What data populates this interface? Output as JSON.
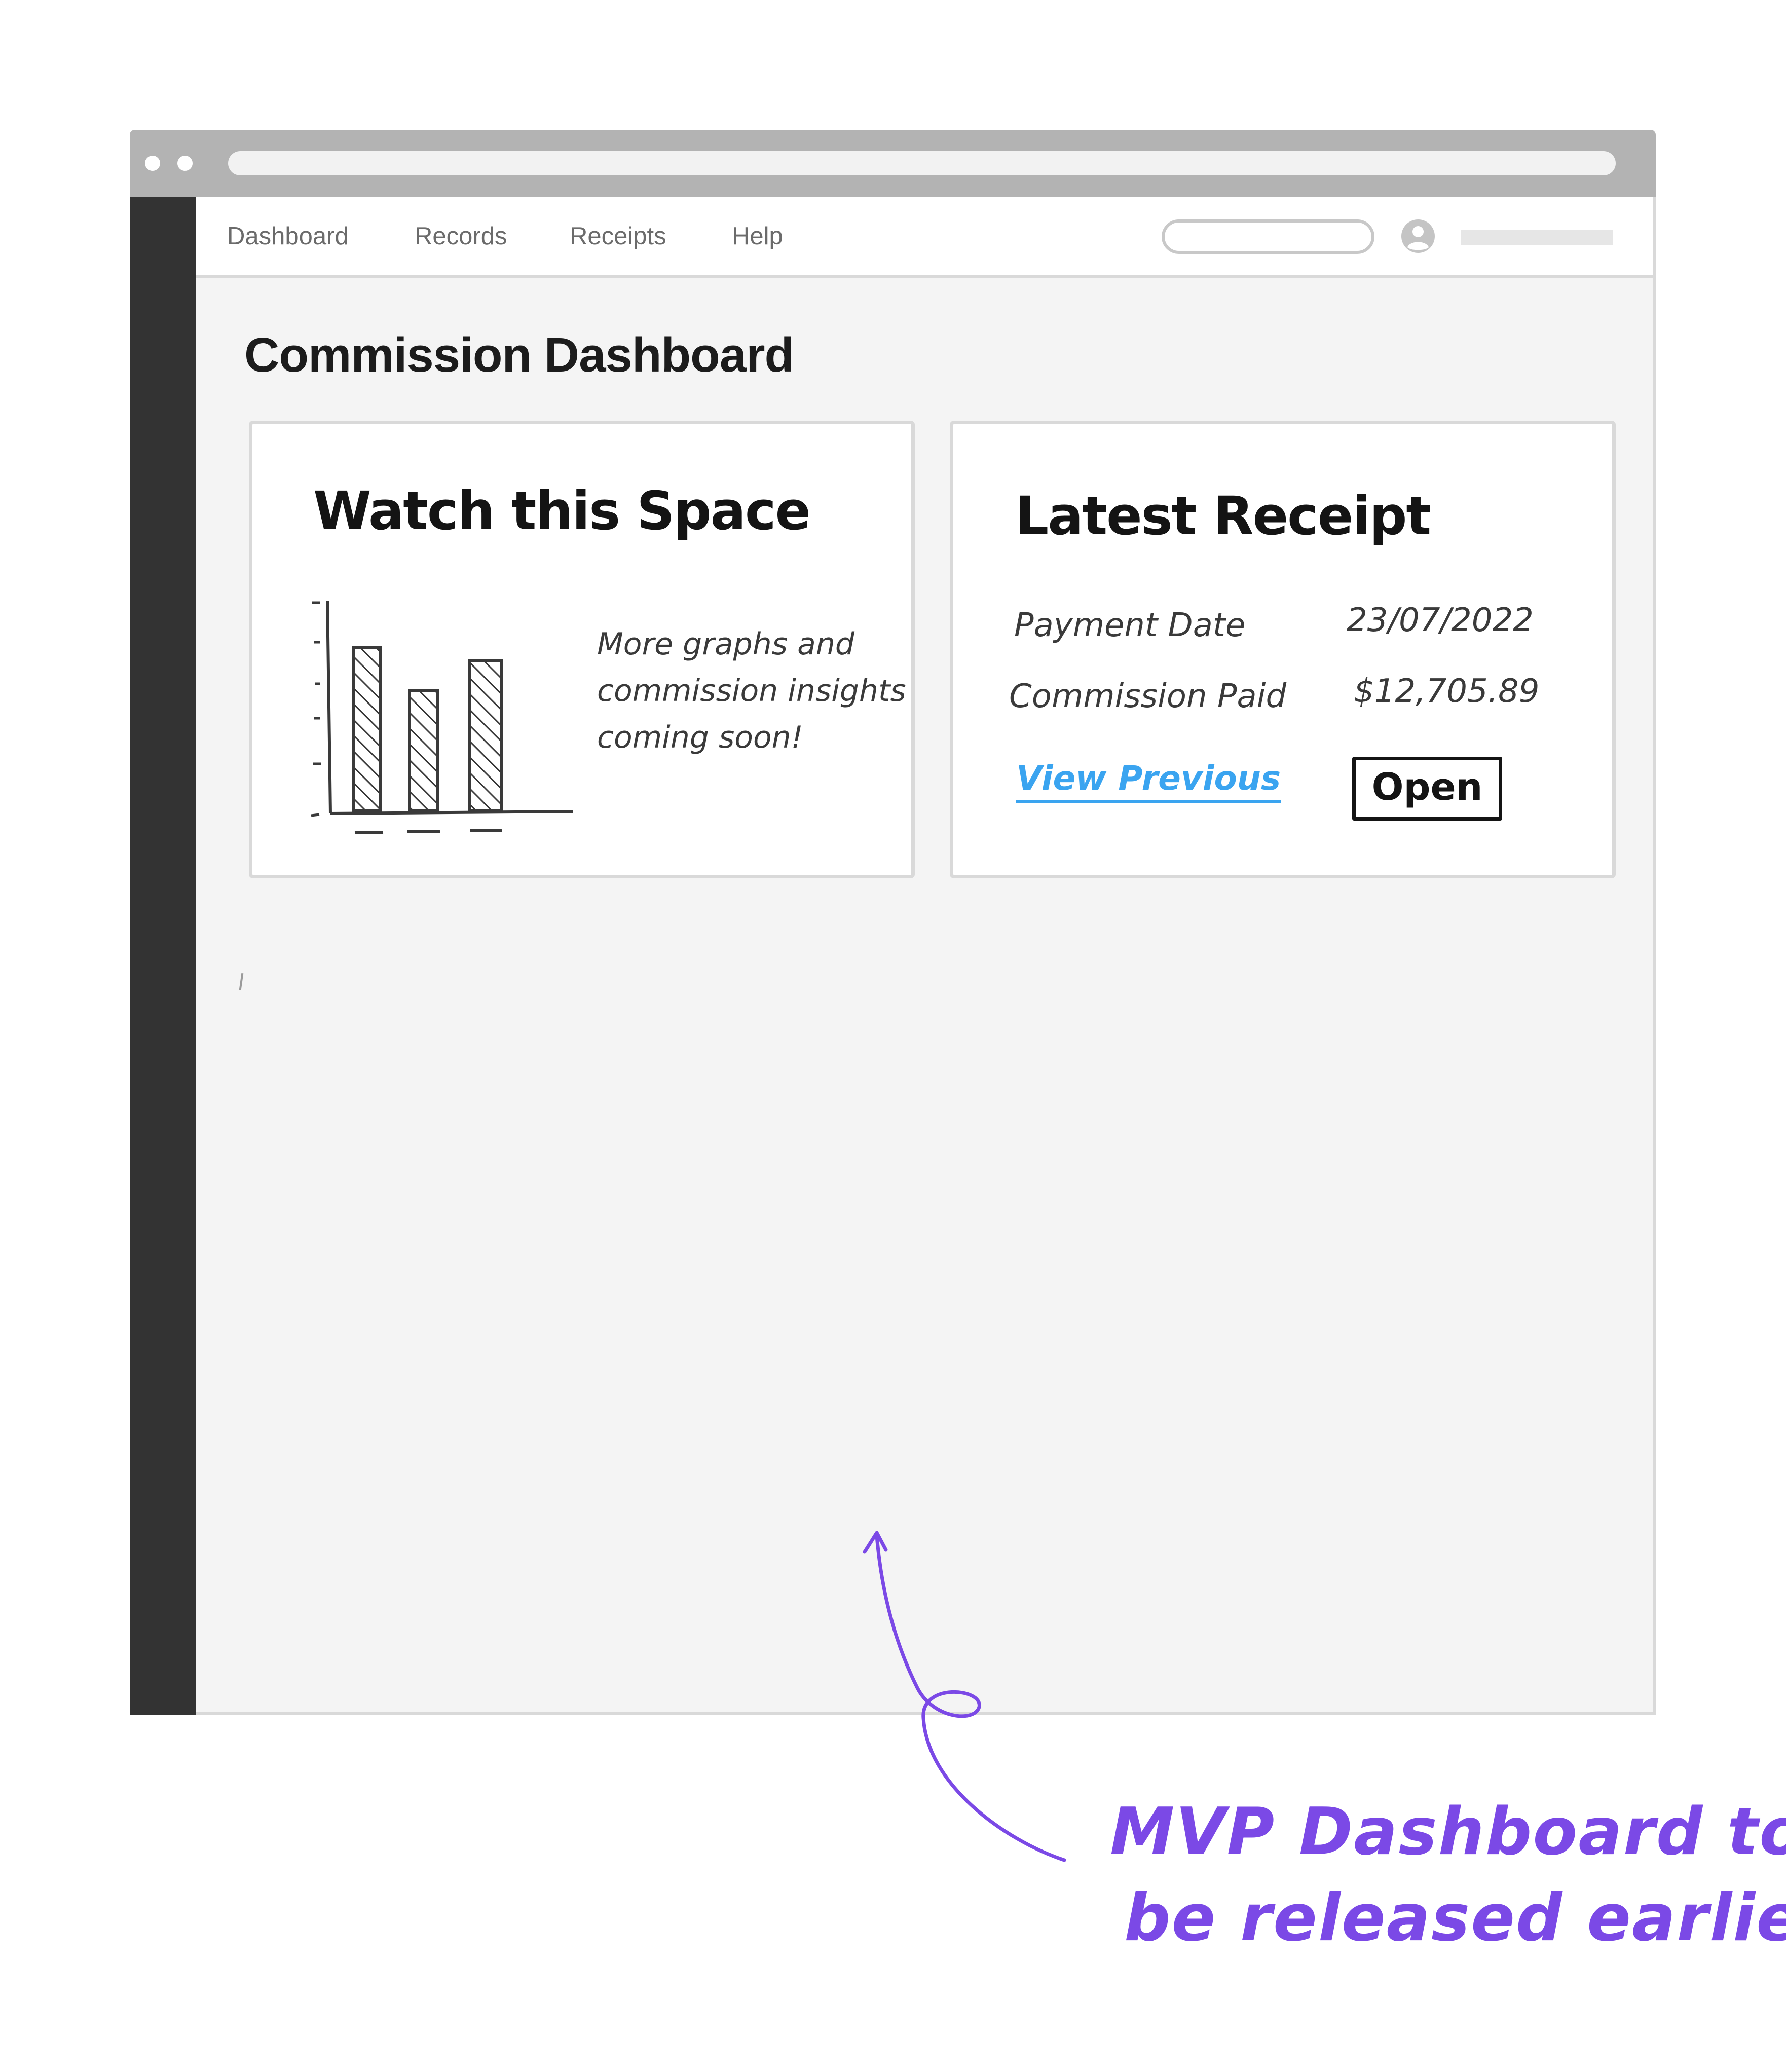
{
  "nav": {
    "items": [
      {
        "label": "Dashboard"
      },
      {
        "label": "Records"
      },
      {
        "label": "Receipts"
      },
      {
        "label": "Help"
      }
    ]
  },
  "page": {
    "title": "Commission Dashboard"
  },
  "watch_card": {
    "heading": "Watch this Space",
    "text": "More graphs and\ncommission insights\ncoming soon!"
  },
  "receipt_card": {
    "heading": "Latest Receipt",
    "payment_date_label": "Payment Date",
    "payment_date_value": "23/07/2022",
    "commission_label": "Commission Paid",
    "commission_value": "$12,705.89",
    "view_previous_label": "View Previous",
    "open_label": "Open"
  },
  "annotation": {
    "line1": "MVP Dashboard to",
    "line2": "be released earlier"
  },
  "colors": {
    "link": "#3aa4f0",
    "annotation": "#7b49e6",
    "sidebar": "#333333",
    "chrome": "#b3b3b3"
  }
}
